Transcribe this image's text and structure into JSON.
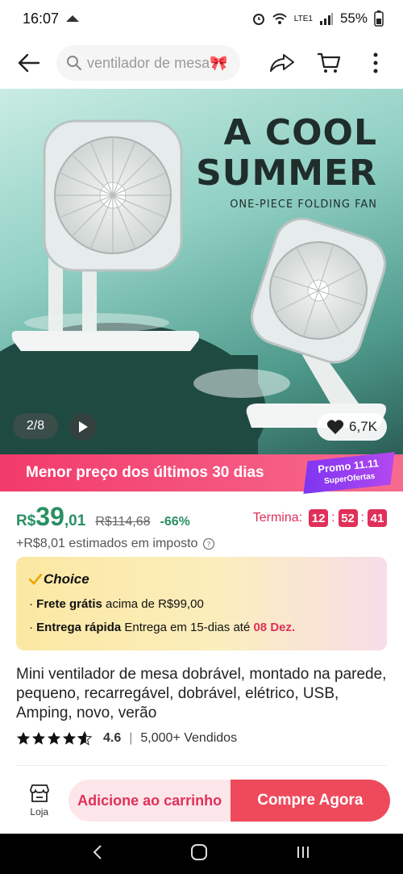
{
  "status": {
    "time": "16:07",
    "battery": "55%",
    "network": "LTE1"
  },
  "search": {
    "placeholder": "ventilador de mesa🎀"
  },
  "hero": {
    "title_line1": "A COOL",
    "title_line2": "SUMMER",
    "title_line3": "ONE-PIECE FOLDING FAN",
    "counter": "2/8",
    "likes": "6,7K"
  },
  "promo": {
    "text": "Menor preço dos últimos 30 dias",
    "badge_title": "Promo 11.11",
    "badge_sub": "SuperOfertas"
  },
  "price": {
    "currency": "R$",
    "integer": "39",
    "decimal": ",01",
    "original": "R$114,68",
    "discount": "-66%",
    "timer_label": "Termina:",
    "timer_h": "12",
    "timer_m": "52",
    "timer_s": "41",
    "tax": "+R$8,01 estimados em imposto"
  },
  "choice": {
    "title": "Choice",
    "free_label": "Frete grátis",
    "free_text": " acima de R$99,00",
    "fast_label": "Entrega rápida",
    "fast_text": " Entrega em 15-dias até ",
    "fast_date": "08 Dez."
  },
  "product": {
    "title": "Mini ventilador de mesa dobrável, montado na parede, pequeno, recarregável, dobrável, elétrico, USB, Amping, novo, verão",
    "rating": "4.6",
    "rating_value": 4.6,
    "sold": "5,000+ Vendidos"
  },
  "bottom": {
    "store_label": "Loja",
    "cart_label": "Adicione ao carrinho",
    "buy_label": "Compre Agora"
  },
  "colors": {
    "accent": "#e0305a",
    "price": "#2a8f63",
    "buy": "#ee4a5c"
  }
}
